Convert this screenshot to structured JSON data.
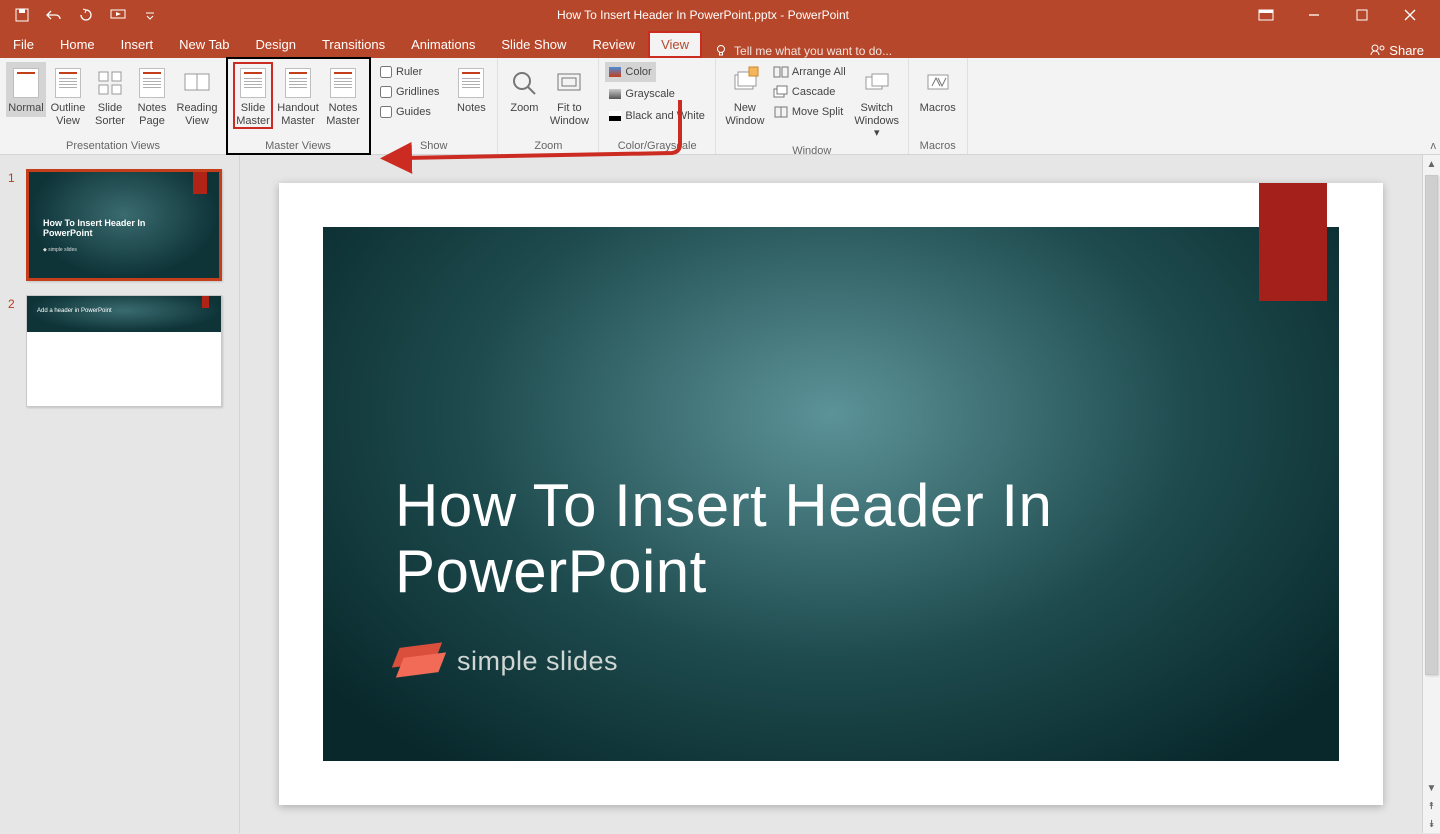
{
  "app_title": "How To Insert Header In PowerPoint.pptx - PowerPoint",
  "tabs": {
    "file": "File",
    "home": "Home",
    "insert": "Insert",
    "newtab": "New Tab",
    "design": "Design",
    "transitions": "Transitions",
    "animations": "Animations",
    "slideshow": "Slide Show",
    "review": "Review",
    "view": "View"
  },
  "tellme": "Tell me what you want to do...",
  "share": "Share",
  "ribbon": {
    "presentation_views": {
      "normal": "Normal",
      "outline": "Outline View",
      "sorter": "Slide Sorter",
      "notes": "Notes Page",
      "reading": "Reading View",
      "group": "Presentation Views"
    },
    "master_views": {
      "slide": "Slide Master",
      "handout": "Handout Master",
      "notes": "Notes Master",
      "group": "Master Views"
    },
    "show": {
      "ruler": "Ruler",
      "gridlines": "Gridlines",
      "guides": "Guides",
      "notes": "Notes",
      "group": "Show"
    },
    "zoom": {
      "zoom": "Zoom",
      "fit": "Fit to Window",
      "group": "Zoom"
    },
    "color": {
      "color": "Color",
      "gray": "Grayscale",
      "bw": "Black and White",
      "group": "Color/Grayscale"
    },
    "window": {
      "neww": "New Window",
      "arrange": "Arrange All",
      "cascade": "Cascade",
      "split": "Move Split",
      "switch": "Switch Windows",
      "group": "Window"
    },
    "macros": {
      "macros": "Macros",
      "group": "Macros"
    }
  },
  "thumbnails": [
    {
      "num": "1",
      "title": "How To Insert Header In PowerPoint",
      "selected": true
    },
    {
      "num": "2",
      "header": "Add a header in PowerPoint",
      "selected": false
    }
  ],
  "slide": {
    "title": "How To Insert Header In PowerPoint",
    "logo": "simple slides"
  }
}
